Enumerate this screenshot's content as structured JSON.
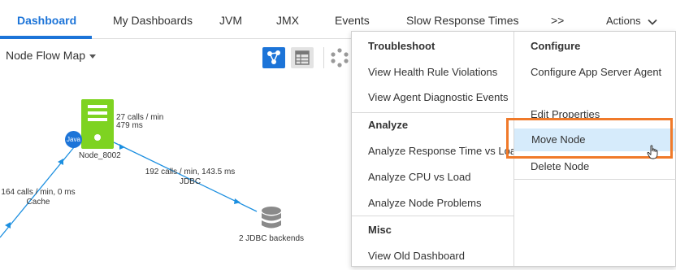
{
  "nav": {
    "tabs": [
      {
        "label": "Dashboard",
        "active": true
      },
      {
        "label": "My Dashboards"
      },
      {
        "label": "JVM"
      },
      {
        "label": "JMX"
      },
      {
        "label": "Events"
      },
      {
        "label": "Slow Response Times"
      },
      {
        "label": ">>"
      }
    ],
    "actions_label": "Actions",
    "accent_color": "#1c74d8"
  },
  "toolbar": {
    "view_selector": "Node Flow Map",
    "view_buttons": [
      "flow-map-icon",
      "grid-table-icon",
      "hexagon-topology-icon"
    ]
  },
  "flow_map": {
    "node": {
      "name": "Node_8002",
      "badge": "Java",
      "icon": "server-icon",
      "color": "#7ed321"
    },
    "edge_calls": {
      "line1": "27 calls / min",
      "line2": "479 ms"
    },
    "edge_jdbc": {
      "line1": "192 calls / min, 143.5 ms",
      "line2": "JDBC"
    },
    "edge_cache": {
      "line1": "164 calls / min, 0 ms",
      "line2": "Cache"
    },
    "backend": {
      "label": "2 JDBC backends",
      "icon": "database-icon"
    },
    "edge_color": "#1c8fe0"
  },
  "menu": {
    "left": {
      "troubleshoot_head": "Troubleshoot",
      "troubleshoot_items": [
        "View Health Rule Violations",
        "View Agent Diagnostic Events"
      ],
      "analyze_head": "Analyze",
      "analyze_items": [
        "Analyze Response Time vs Load",
        "Analyze CPU vs Load",
        "Analyze Node Problems"
      ],
      "misc_head": "Misc",
      "misc_items": [
        "View Old Dashboard"
      ]
    },
    "right": {
      "configure_head": "Configure",
      "items": [
        "Configure App Server Agent",
        "Edit Properties",
        "Move Node",
        "Delete Node"
      ],
      "hovered": "Move Node",
      "highlight_color": "#f07a2a"
    }
  }
}
